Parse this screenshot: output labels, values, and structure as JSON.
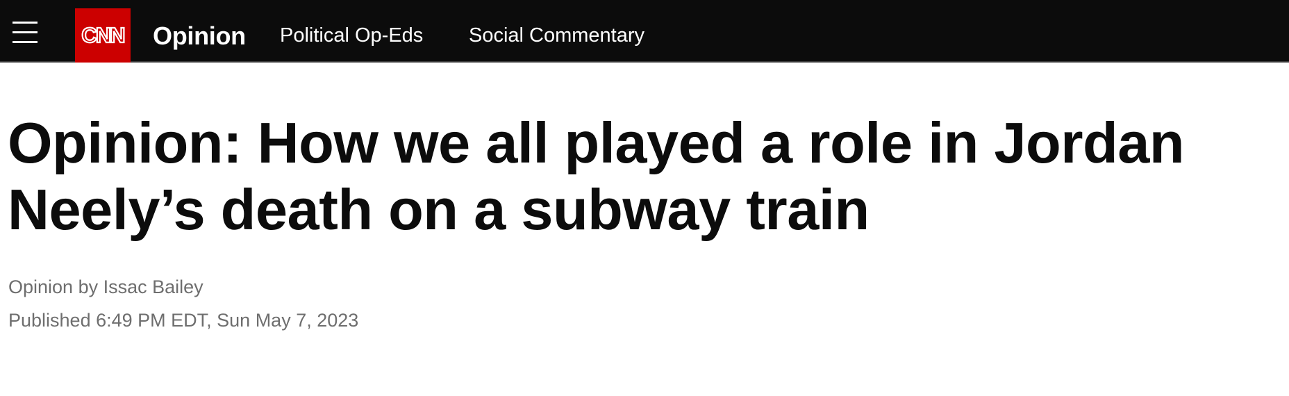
{
  "header": {
    "logo_text": "CNN",
    "section_title": "Opinion",
    "nav_links": [
      "Political Op-Eds",
      "Social Commentary"
    ],
    "icons": {
      "menu": "hamburger-menu-icon",
      "logo": "cnn-logo"
    },
    "colors": {
      "bar": "#0c0c0c",
      "logo_bg": "#cc0000"
    }
  },
  "article": {
    "headline": "Opinion: How we all played a role in Jordan Neely’s death on a subway train",
    "byline_prefix": "Opinion by",
    "author": "Issac Bailey",
    "published": "Published 6:49 PM EDT, Sun May 7, 2023"
  }
}
